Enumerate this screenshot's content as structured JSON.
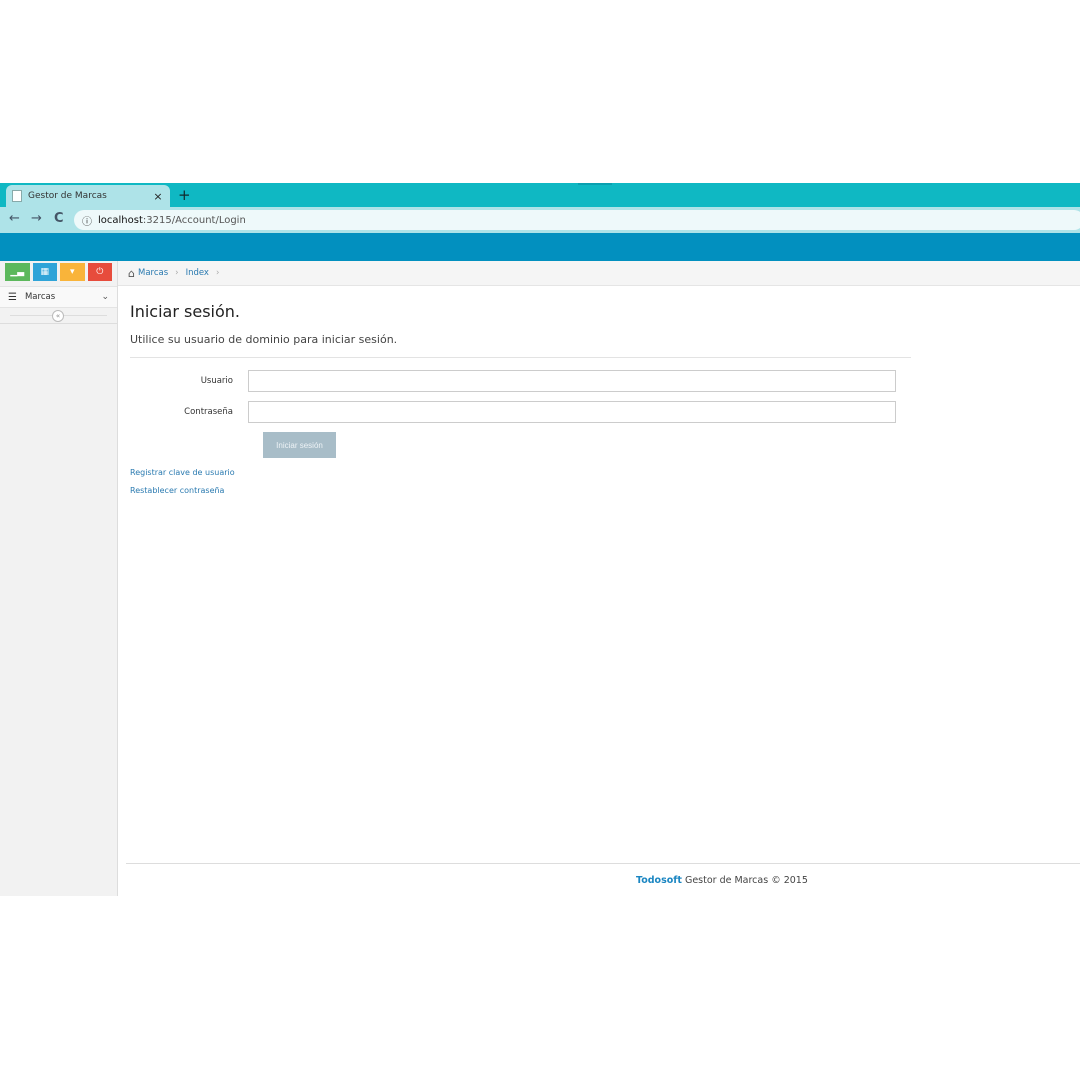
{
  "browser": {
    "tab_title": "Gestor de Marcas",
    "tab_close": "×",
    "new_tab": "+",
    "url_host": "localhost",
    "url_path": ":3215/Account/Login",
    "back": "←",
    "forward": "→",
    "reload": "C"
  },
  "sidebar": {
    "shortcuts": [
      {
        "icon": "signal-icon",
        "color": "#5cb85c"
      },
      {
        "icon": "calendar-icon",
        "color": "#2fa4d8"
      },
      {
        "icon": "caret-down-icon",
        "color": "#f9b43a"
      },
      {
        "icon": "power-icon",
        "color": "#e74c3c"
      }
    ],
    "menu": [
      {
        "label": "Marcas",
        "icon": "list-icon"
      }
    ],
    "collapse_icon": "«"
  },
  "breadcrumb": {
    "items": [
      "Marcas",
      "Index"
    ],
    "separator": "›"
  },
  "login": {
    "title": "Iniciar sesión.",
    "subtitle": "Utilice su usuario de dominio para iniciar sesión.",
    "username_label": "Usuario",
    "username_value": "",
    "password_label": "Contraseña",
    "password_value": "",
    "submit_label": "Iniciar sesión",
    "link_register": "Registrar clave de usuario",
    "link_reset": "Restablecer contraseña"
  },
  "footer": {
    "brand": "Todosoft",
    "text": " Gestor de Marcas © 2015"
  },
  "colors": {
    "tabstrip": "#0fb8c3",
    "header": "#0290bf",
    "link": "#2a7ab0",
    "button": "#a8bdc8"
  }
}
